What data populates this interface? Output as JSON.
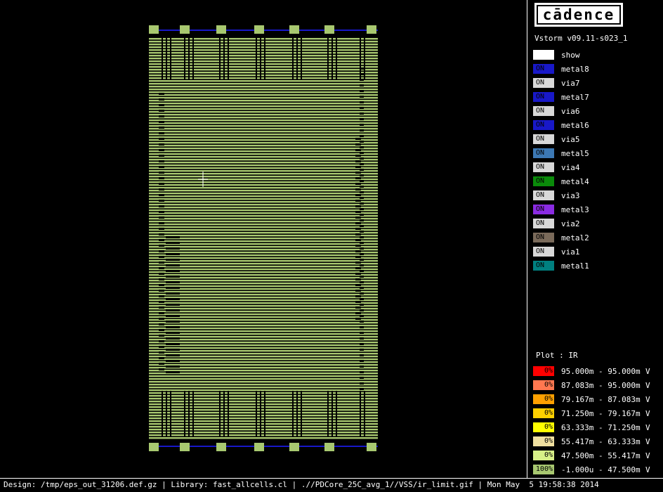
{
  "app": {
    "logo_text": "cādence",
    "version": "Vstorm v09.11-s023_1"
  },
  "layers": [
    {
      "state": "",
      "name": "show",
      "color": "#ffffff"
    },
    {
      "state": "ON",
      "name": "metal8",
      "color": "#1818c8"
    },
    {
      "state": "ON",
      "name": "via7",
      "color": "#d8d8d8"
    },
    {
      "state": "ON",
      "name": "metal7",
      "color": "#1818c8"
    },
    {
      "state": "ON",
      "name": "via6",
      "color": "#d8d8d8"
    },
    {
      "state": "ON",
      "name": "metal6",
      "color": "#1818c8"
    },
    {
      "state": "ON",
      "name": "via5",
      "color": "#d8d8d8"
    },
    {
      "state": "ON",
      "name": "metal5",
      "color": "#3c78b4"
    },
    {
      "state": "ON",
      "name": "via4",
      "color": "#d8d8d8"
    },
    {
      "state": "ON",
      "name": "metal4",
      "color": "#0a8a0a"
    },
    {
      "state": "ON",
      "name": "via3",
      "color": "#d8d8d8"
    },
    {
      "state": "ON",
      "name": "metal3",
      "color": "#8a2be2"
    },
    {
      "state": "ON",
      "name": "via2",
      "color": "#d8d8d8"
    },
    {
      "state": "ON",
      "name": "metal2",
      "color": "#7a6a5a"
    },
    {
      "state": "ON",
      "name": "via1",
      "color": "#d8d8d8"
    },
    {
      "state": "ON",
      "name": "metal1",
      "color": "#008080"
    }
  ],
  "plot": {
    "label": "Plot : IR",
    "legend": [
      {
        "pct": "0%",
        "range": "95.000m - 95.000m",
        "unit": "V",
        "color": "#ff0000"
      },
      {
        "pct": "0%",
        "range": "87.083m - 95.000m",
        "unit": "V",
        "color": "#ff7850"
      },
      {
        "pct": "0%",
        "range": "79.167m - 87.083m",
        "unit": "V",
        "color": "#ffa000"
      },
      {
        "pct": "0%",
        "range": "71.250m - 79.167m",
        "unit": "V",
        "color": "#ffd000"
      },
      {
        "pct": "0%",
        "range": "63.333m - 71.250m",
        "unit": "V",
        "color": "#ffff00"
      },
      {
        "pct": "0%",
        "range": "55.417m - 63.333m",
        "unit": "V",
        "color": "#f0e0a0"
      },
      {
        "pct": "0%",
        "range": "47.500m - 55.417m",
        "unit": "V",
        "color": "#d8f088"
      },
      {
        "pct": "100%",
        "range": "-1.000u - 47.500m",
        "unit": "V",
        "color": "#a8c870"
      }
    ]
  },
  "status_bar": "Design: /tmp/eps_out_31206.def.gz | Library: fast_allcells.cl | .//PDCore_25C_avg_1//VSS/ir_limit.gif | Mon May  5 19:58:38 2014"
}
